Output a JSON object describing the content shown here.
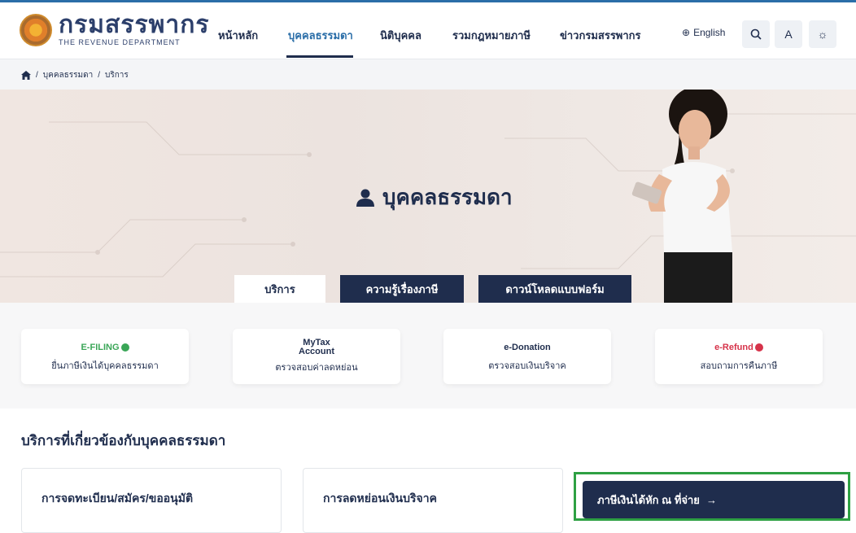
{
  "header": {
    "logo_th": "กรมสรรพากร",
    "logo_en": "THE REVENUE DEPARTMENT",
    "nav": [
      "หน้าหลัก",
      "บุคคลธรรมดา",
      "นิติบุคคล",
      "รวมกฎหมายภาษี",
      "ข่าวกรมสรรพากร"
    ],
    "active_nav": "บุคคลธรรมดา",
    "language": "English",
    "font_size_button": "A"
  },
  "breadcrumb": {
    "items": [
      "บุคคลธรรมดา",
      "บริการ"
    ],
    "separator": "/"
  },
  "hero": {
    "title": "บุคคลธรรมดา",
    "tabs": [
      "บริการ",
      "ความรู้เรื่องภาษี",
      "ดาวน์โหลดแบบฟอร์ม"
    ],
    "active_tab": "บริการ"
  },
  "quick_services": [
    {
      "logo": "E-FILING",
      "label": "ยื่นภาษีเงินได้บุคคลธรรมดา"
    },
    {
      "logo_top": "MyTax",
      "logo_bottom": "Account",
      "label": "ตรวจสอบค่าลดหย่อน"
    },
    {
      "logo": "e-Donation",
      "label": "ตรวจสอบเงินบริจาค"
    },
    {
      "logo": "e-Refund",
      "label": "สอบถามการคืนภาษี"
    }
  ],
  "related": {
    "title": "บริการที่เกี่ยวข้องกับบุคคลธรรมดา",
    "cards": [
      "การจดทะเบียน/สมัคร/ขออนุมัติ",
      "การลดหย่อนเงินบริจาค"
    ],
    "cta": "ภาษีเงินได้หัก ณ ที่จ่าย"
  },
  "colors": {
    "navy": "#1f2d4d",
    "accent_blue": "#2b6ea8",
    "highlight": "#2ea043",
    "efiling_green": "#3aa657"
  }
}
